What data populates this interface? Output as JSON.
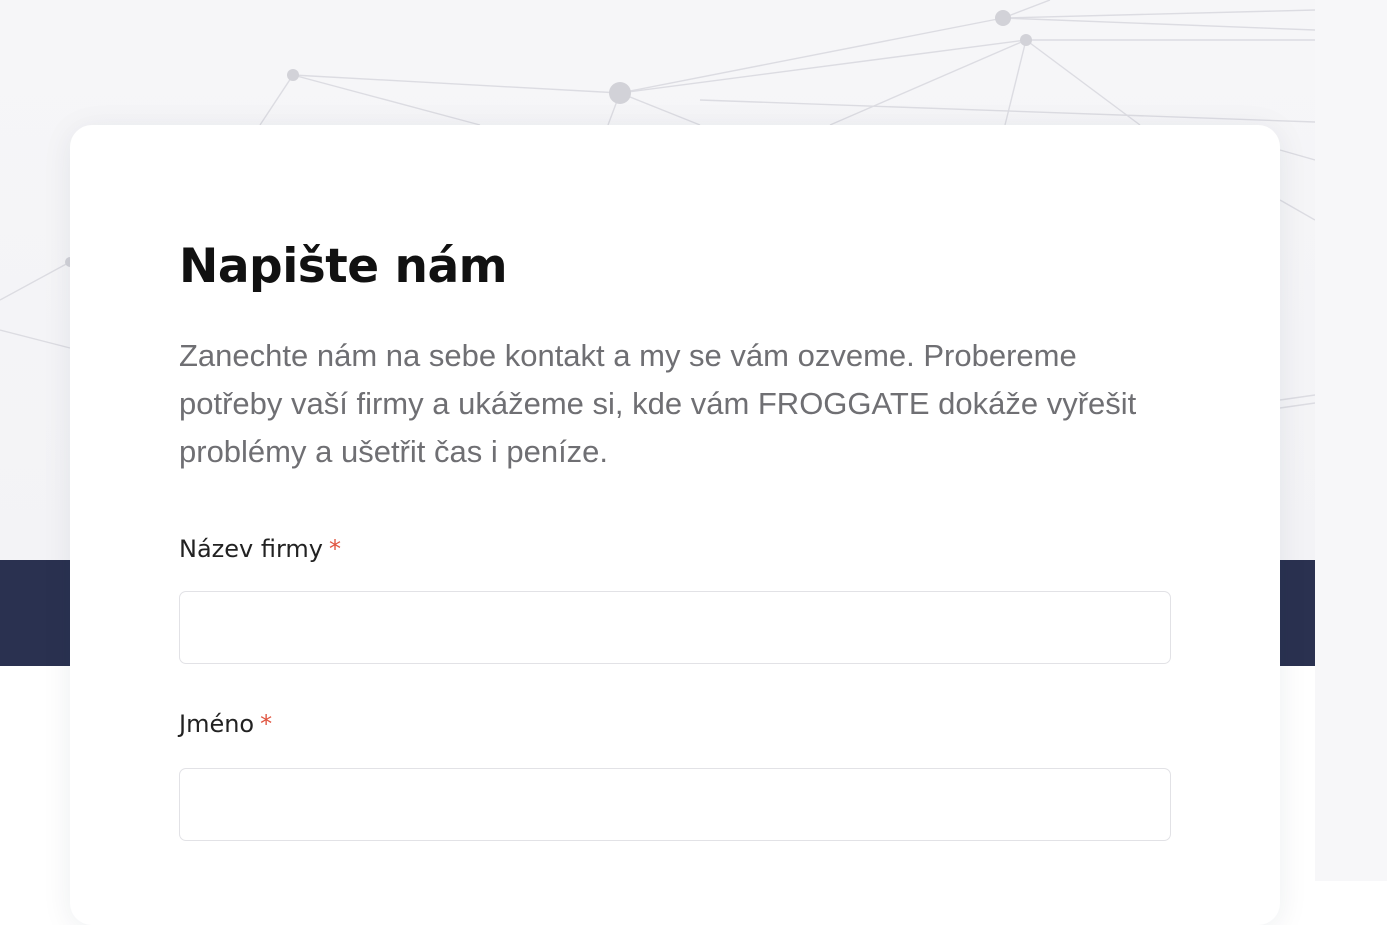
{
  "contact_form": {
    "title": "Napište nám",
    "description": "Zanechte nám na sebe kontakt a my se vám ozveme. Probereme potřeby vaší firmy a ukážeme si, kde vám FROGGATE dokáže vyřešit problémy a ušetřit čas i peníze.",
    "fields": [
      {
        "label": "Název firmy",
        "required_mark": "*",
        "value": "",
        "placeholder": ""
      },
      {
        "label": "Jméno",
        "required_mark": "*",
        "value": "",
        "placeholder": ""
      }
    ]
  },
  "colors": {
    "dark_band": "#2a3150",
    "required_mark": "#e0543f",
    "title": "#111111",
    "description": "#6f6f73"
  }
}
